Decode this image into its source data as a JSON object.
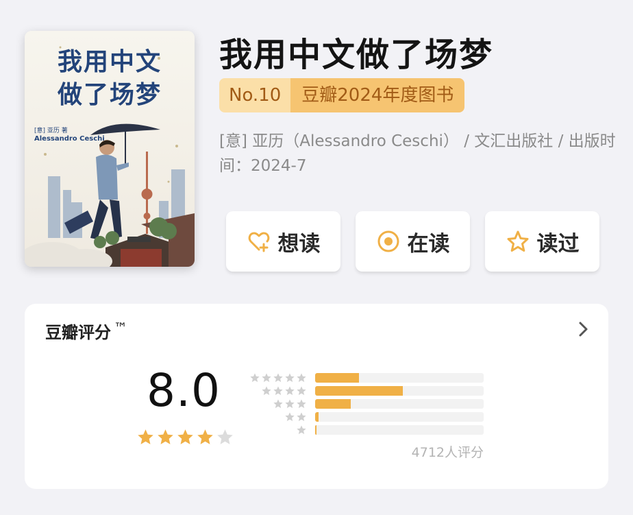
{
  "book": {
    "title": "我用中文做了场梦",
    "cover_title_line1": "我用中文",
    "cover_title_line2": "做了场梦",
    "cover_author_cn": "[意] 亚历 著",
    "cover_author_en": "Alessandro Ceschi",
    "meta_line": "[意] 亚历（Alessandro Ceschi） / 文汇出版社 / 出版时间：2024-7"
  },
  "badge": {
    "rank": "No.10",
    "name": "豆瓣2024年度图书"
  },
  "actions": [
    {
      "label": "想读",
      "icon": "heart-plus-icon"
    },
    {
      "label": "在读",
      "icon": "target-circle-icon"
    },
    {
      "label": "读过",
      "icon": "star-outline-icon"
    }
  ],
  "rating": {
    "heading": "豆瓣评分",
    "tm": "™",
    "score": "8.0",
    "stars_filled": 4,
    "stars_total": 5,
    "count_text": "4712人评分",
    "distribution": [
      {
        "stars": 5,
        "fraction": 0.26
      },
      {
        "stars": 4,
        "fraction": 0.52
      },
      {
        "stars": 3,
        "fraction": 0.21
      },
      {
        "stars": 2,
        "fraction": 0.02
      },
      {
        "stars": 1,
        "fraction": 0.005
      }
    ]
  },
  "colors": {
    "accent": "#f0b046",
    "star_empty": "#dcdcdc",
    "badge_left": "#fbdfa8",
    "badge_right": "#f6c471",
    "badge_text": "#a15b16"
  }
}
